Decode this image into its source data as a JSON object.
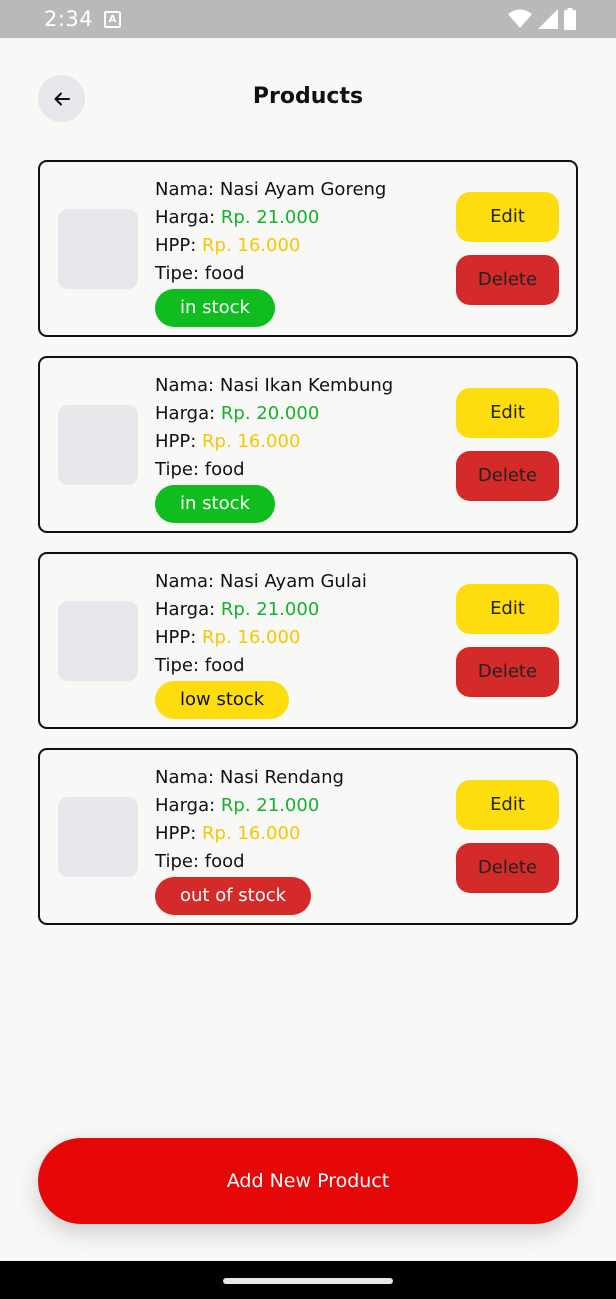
{
  "status_bar": {
    "time": "2:34",
    "notification_glyph": "A"
  },
  "header": {
    "title": "Products"
  },
  "labels": {
    "name": "Nama: ",
    "price": "Harga: ",
    "cost": "HPP: ",
    "type": "Tipe: "
  },
  "buttons": {
    "edit": "Edit",
    "delete": "Delete",
    "add": "Add New Product"
  },
  "products": [
    {
      "name": "Nasi Ayam Goreng",
      "price": "Rp. 21.000",
      "cost": "Rp. 16.000",
      "type": "food",
      "stock": "in stock"
    },
    {
      "name": "Nasi Ikan Kembung",
      "price": "Rp. 20.000",
      "cost": "Rp. 16.000",
      "type": "food",
      "stock": "in stock"
    },
    {
      "name": "Nasi Ayam Gulai",
      "price": "Rp. 21.000",
      "cost": "Rp. 16.000",
      "type": "food",
      "stock": "low stock"
    },
    {
      "name": "Nasi Rendang",
      "price": "Rp. 21.000",
      "cost": "Rp. 16.000",
      "type": "food",
      "stock": "out of stock"
    }
  ],
  "colors": {
    "primary_red": "#e60808",
    "in_stock_green": "#0fbd1e",
    "low_stock_yellow": "#fedd0e",
    "out_of_stock_red": "#d52a2a",
    "price_green": "#14b22b",
    "cost_yellow": "#f7c600"
  },
  "icons": {
    "back": "arrow-left-icon",
    "wifi": "wifi-icon",
    "signal": "signal-icon",
    "battery": "battery-icon"
  }
}
